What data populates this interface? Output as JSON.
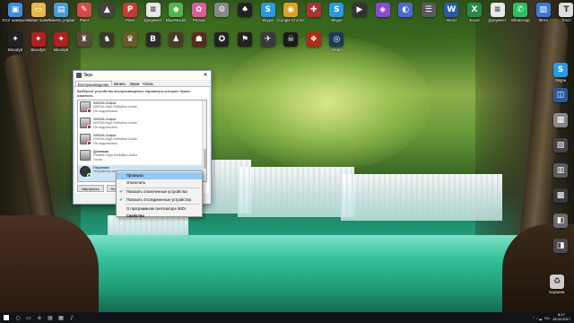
{
  "desktop": {
    "top_row": [
      {
        "label": "Этот компьютер",
        "icon": "computer-icon",
        "color": "#3a8ee6",
        "glyph": "▣"
      },
      {
        "label": "Новая папка",
        "icon": "folder-icon",
        "color": "#e8b84a",
        "glyph": "▭"
      },
      {
        "label": "Панель управления",
        "icon": "control-panel-icon",
        "color": "#4a9ad6",
        "glyph": "▤"
      },
      {
        "label": "Paint",
        "icon": "paint-icon",
        "color": "#d84a4a",
        "glyph": "✎"
      },
      {
        "label": "",
        "icon": "app-icon",
        "color": "#444444",
        "glyph": "▲"
      },
      {
        "label": "Pixel",
        "icon": "pixel-icon",
        "color": "#c83a3a",
        "glyph": "P"
      },
      {
        "label": "Документ",
        "icon": "document-icon",
        "color": "#e8e8e8",
        "glyph": "≡"
      },
      {
        "label": "BlueStacks",
        "icon": "bluestacks-icon",
        "color": "#4ab84a",
        "glyph": "◆"
      },
      {
        "label": "Picasa",
        "icon": "picasa-icon",
        "color": "#e05a9a",
        "glyph": "✿"
      },
      {
        "label": "",
        "icon": "app-icon",
        "color": "#888888",
        "glyph": "⚙"
      },
      {
        "label": "",
        "icon": "app-icon",
        "color": "#222222",
        "glyph": "♠"
      },
      {
        "label": "Skype",
        "icon": "skype-icon",
        "color": "#2a9ae6",
        "glyph": "S"
      },
      {
        "label": "Google Chrome",
        "icon": "chrome-icon",
        "color": "#e0a020",
        "glyph": "◉"
      },
      {
        "label": "",
        "icon": "app-icon",
        "color": "#b03030",
        "glyph": "✚"
      },
      {
        "label": "Skype",
        "icon": "skype-icon",
        "color": "#2a9ae6",
        "glyph": "S"
      },
      {
        "label": "",
        "icon": "app-icon",
        "color": "#333333",
        "glyph": "▶"
      },
      {
        "label": "",
        "icon": "app-icon",
        "color": "#8a4ad6",
        "glyph": "◈"
      },
      {
        "label": "",
        "icon": "app-icon",
        "color": "#4a6ad6",
        "glyph": "◐"
      },
      {
        "label": "",
        "icon": "app-icon",
        "color": "#5a5a5a",
        "glyph": "☰"
      },
      {
        "label": "Word",
        "icon": "word-icon",
        "color": "#2a5aa6",
        "glyph": "W"
      },
      {
        "label": "Excel",
        "icon": "excel-icon",
        "color": "#2a8a4a",
        "glyph": "X"
      },
      {
        "label": "Документ",
        "icon": "document-icon",
        "color": "#e8e8e8",
        "glyph": "≡"
      },
      {
        "label": "WhatsApp",
        "icon": "whatsapp-icon",
        "color": "#2ac060",
        "glyph": "✆"
      },
      {
        "label": "Фото",
        "icon": "photo-icon",
        "color": "#3a7ad6",
        "glyph": "▨"
      },
      {
        "label": "Текст",
        "icon": "text-icon",
        "color": "#dddddd",
        "glyph": "T"
      }
    ],
    "second_row": [
      {
        "label": "Bloody6",
        "icon": "bloody-icon",
        "color": "#222222",
        "glyph": "✦"
      },
      {
        "label": "Bloody6",
        "icon": "bloody-icon",
        "color": "#b02020",
        "glyph": "✦"
      },
      {
        "label": "Bloody6",
        "icon": "bloody-icon",
        "color": "#b02020",
        "glyph": "✦"
      },
      {
        "label": "",
        "icon": "game-icon",
        "color": "#5a4a3a",
        "glyph": "♜"
      },
      {
        "label": "",
        "icon": "game-icon",
        "color": "#3a3a2a",
        "glyph": "♞"
      },
      {
        "label": "",
        "icon": "game-icon",
        "color": "#6a5a2a",
        "glyph": "♛"
      },
      {
        "label": "",
        "icon": "game-icon",
        "color": "#2a2a2a",
        "glyph": "B"
      },
      {
        "label": "",
        "icon": "game-icon",
        "color": "#4a3a2a",
        "glyph": "♟"
      },
      {
        "label": "",
        "icon": "game-icon",
        "color": "#5a2a1a",
        "glyph": "☗"
      },
      {
        "label": "",
        "icon": "game-icon",
        "color": "#222222",
        "glyph": "✪"
      },
      {
        "label": "",
        "icon": "game-icon",
        "color": "#222222",
        "glyph": "⚑"
      },
      {
        "label": "",
        "icon": "game-icon",
        "color": "#3a3a3a",
        "glyph": "✈"
      },
      {
        "label": "",
        "icon": "counter-strike-icon",
        "color": "#1a1a1a",
        "glyph": "☠"
      },
      {
        "label": "",
        "icon": "game-icon",
        "color": "#b02a1a",
        "glyph": "❖"
      },
      {
        "label": "Steam",
        "icon": "steam-icon",
        "color": "#1a3a5a",
        "glyph": "◎"
      }
    ],
    "right_column": [
      {
        "label": "Skype",
        "icon": "skype-icon",
        "color": "#2a9ae6",
        "glyph": "S"
      },
      {
        "label": "",
        "icon": "app-icon",
        "color": "#2a5a9a",
        "glyph": "◫"
      },
      {
        "label": "",
        "icon": "app-icon",
        "color": "#888888",
        "glyph": "▦"
      },
      {
        "label": "",
        "icon": "app-icon",
        "color": "#444444",
        "glyph": "▧"
      },
      {
        "label": "",
        "icon": "app-icon",
        "color": "#5a5a5a",
        "glyph": "▥"
      },
      {
        "label": "",
        "icon": "app-icon",
        "color": "#3a3a3a",
        "glyph": "▩"
      },
      {
        "label": "",
        "icon": "app-icon",
        "color": "#6a6a6a",
        "glyph": "◧"
      },
      {
        "label": "",
        "icon": "app-icon",
        "color": "#4a4a4a",
        "glyph": "◨"
      }
    ],
    "recycle_bin": {
      "label": "Корзина",
      "icon": "recycle-bin-icon",
      "color": "#cccccc",
      "glyph": "♻"
    }
  },
  "sound_dialog": {
    "title": "Звук",
    "close_glyph": "✕",
    "tabs": [
      "Воспроизведение",
      "Запись",
      "Звуки",
      "Связь"
    ],
    "instructions": "Выберите устройство воспроизведения, параметры которого нужно изменить:",
    "devices": [
      {
        "name": "NVIDIA Output",
        "desc": "NVIDIA High Definition Audio",
        "status": "Не подключено",
        "type": "monitor",
        "state": "off",
        "selected": false
      },
      {
        "name": "NVIDIA Output",
        "desc": "NVIDIA High Definition Audio",
        "status": "Не подключено",
        "type": "monitor",
        "state": "off",
        "selected": false
      },
      {
        "name": "NVIDIA Output",
        "desc": "NVIDIA High Definition Audio",
        "status": "Не подключено",
        "type": "monitor",
        "state": "off",
        "selected": false
      },
      {
        "name": "Динамики",
        "desc": "Realtek High Definition Audio",
        "status": "Готов",
        "type": "speaker",
        "state": "ready",
        "selected": false
      },
      {
        "name": "Наушники",
        "desc": "Устройство по умолчанию",
        "status": "",
        "type": "headphones",
        "state": "ok",
        "selected": true
      }
    ],
    "buttons": {
      "configure": "Настроить",
      "default": "По умолчанию"
    }
  },
  "context_menu": {
    "items": [
      {
        "label": "Проверка",
        "hover": true,
        "checked": false,
        "bold": false
      },
      {
        "label": "Отключить",
        "hover": false,
        "checked": false,
        "bold": false
      },
      {
        "separator": true
      },
      {
        "label": "Показать отключенные устройства",
        "hover": false,
        "checked": true,
        "bold": false
      },
      {
        "label": "Показать отсоединенные устройства",
        "hover": false,
        "checked": true,
        "bold": false
      },
      {
        "separator": true
      },
      {
        "label": "О программном синтезаторе MIDI",
        "hover": false,
        "checked": false,
        "bold": false
      },
      {
        "label": "Свойства",
        "hover": false,
        "checked": false,
        "bold": true
      }
    ]
  },
  "taskbar": {
    "icons": [
      {
        "name": "search-icon",
        "glyph": "○"
      },
      {
        "name": "task-view-icon",
        "glyph": "▭"
      },
      {
        "name": "edge-icon",
        "glyph": "e"
      },
      {
        "name": "explorer-icon",
        "glyph": "▤"
      },
      {
        "name": "store-icon",
        "glyph": "▦"
      },
      {
        "name": "sound-app-icon",
        "glyph": "♪"
      }
    ],
    "tray_lang": "RU",
    "tray_glyphs": "⌃ ♪ ▂",
    "time": "8:17",
    "date": "15.02.2017"
  }
}
